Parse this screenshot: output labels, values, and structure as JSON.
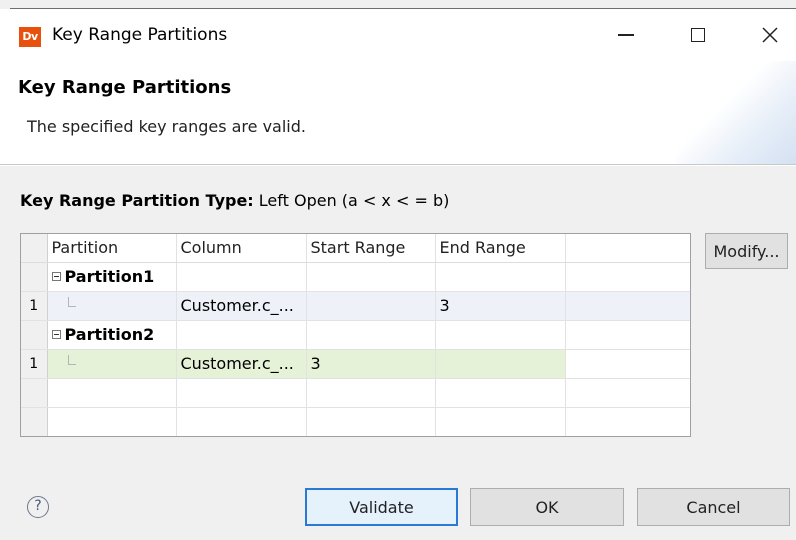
{
  "window": {
    "app_icon_text": "Dv",
    "title": "Key Range Partitions"
  },
  "banner": {
    "title": "Key Range Partitions",
    "message": "The specified key ranges are valid."
  },
  "partition_type": {
    "label": "Key Range Partition Type:",
    "value": "Left Open (a < x < = b)"
  },
  "table": {
    "columns": [
      "Partition",
      "Column",
      "Start Range",
      "End Range"
    ],
    "groups": [
      {
        "name": "Partition1",
        "rows": [
          {
            "index": "1",
            "column": "Customer.c_...",
            "start": "",
            "end": "3"
          }
        ]
      },
      {
        "name": "Partition2",
        "rows": [
          {
            "index": "1",
            "column": "Customer.c_...",
            "start": "3",
            "end": ""
          }
        ]
      }
    ]
  },
  "buttons": {
    "modify": "Modify...",
    "validate": "Validate",
    "ok": "OK",
    "cancel": "Cancel"
  },
  "help_symbol": "?",
  "icons": {
    "minimize": "minimize-icon",
    "maximize": "maximize-icon",
    "close": "close-icon",
    "help": "help-icon",
    "expander": "collapse-icon"
  },
  "colors": {
    "app_icon": "#e8500e",
    "validate_border": "#2b79d7",
    "selected_row": "#eef2f8",
    "highlight_row": "#e5f2d8"
  }
}
